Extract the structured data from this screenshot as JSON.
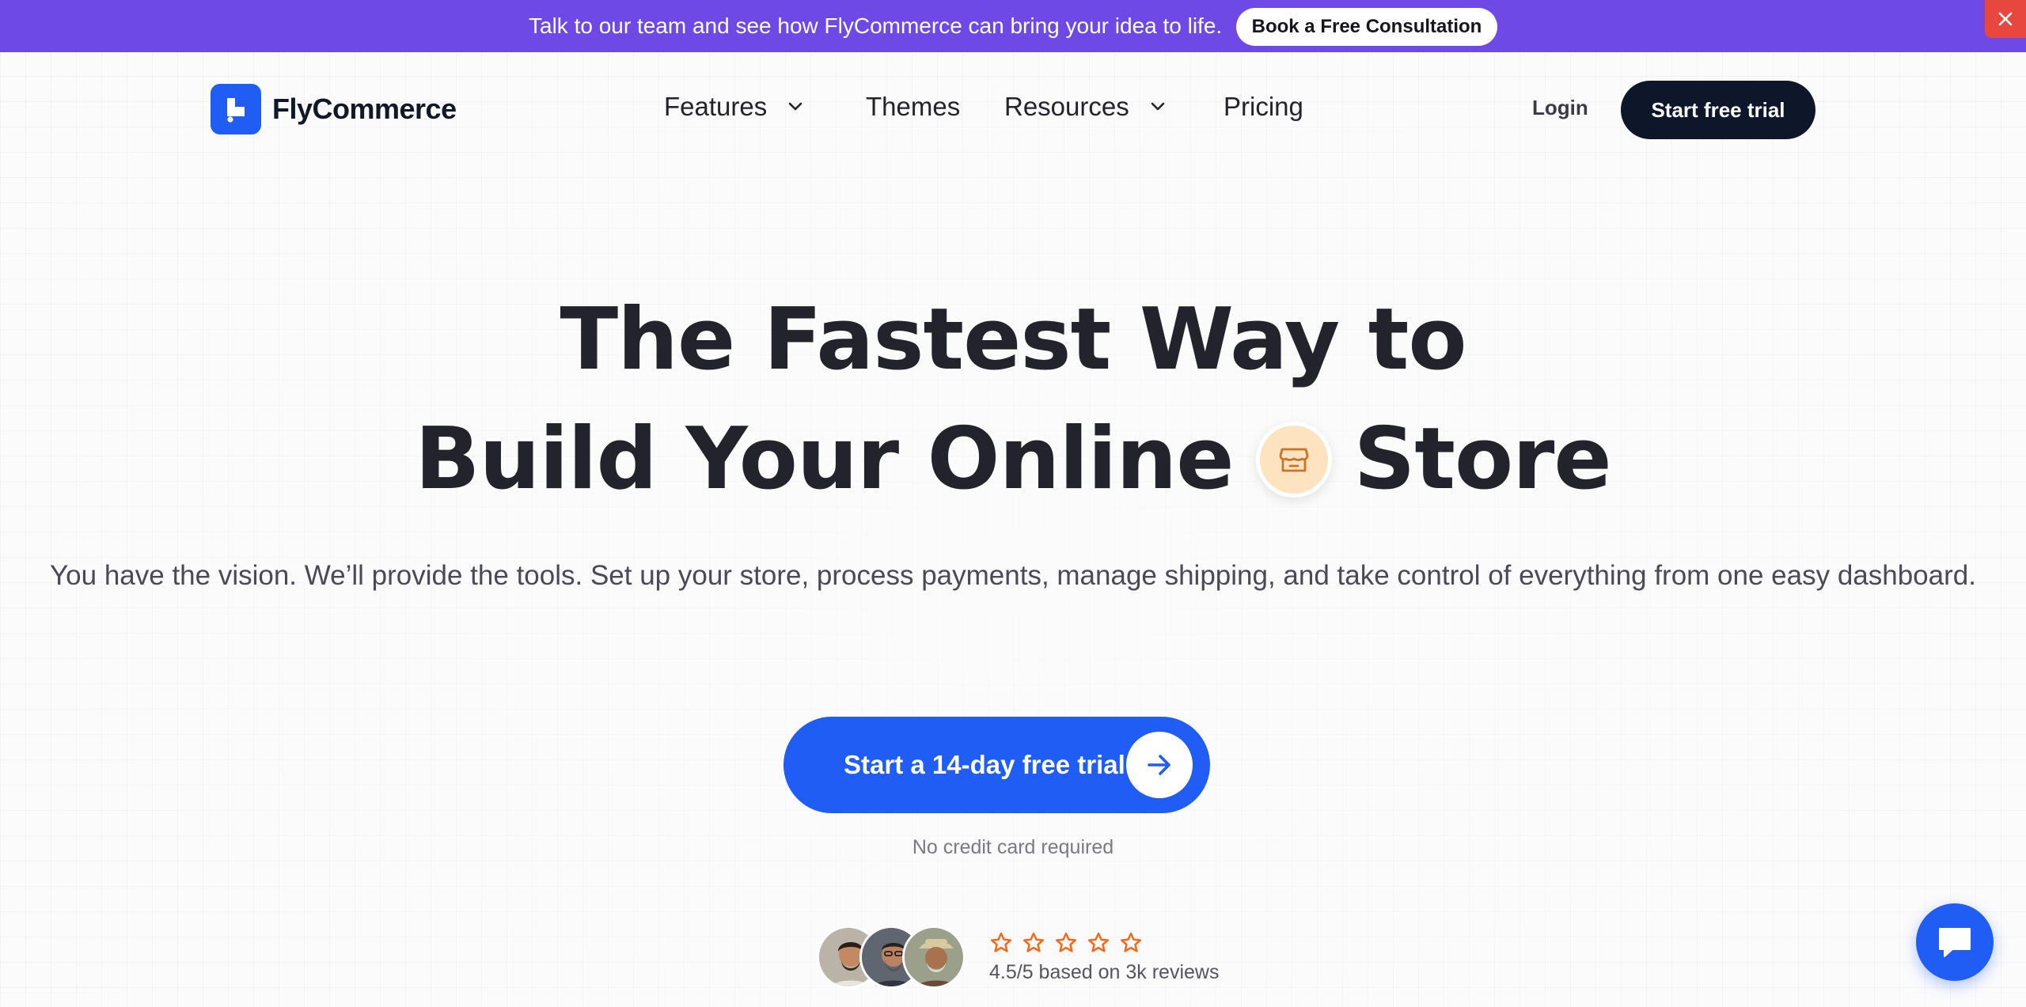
{
  "announcement": {
    "text": "Talk to our team and see how FlyCommerce can bring your idea to life.",
    "button_label": "Book a Free Consultation",
    "close_icon": "close-icon",
    "background_color": "#6f49e6"
  },
  "header": {
    "brand": "FlyCommerce",
    "nav": {
      "features": "Features",
      "themes": "Themes",
      "resources": "Resources",
      "pricing": "Pricing"
    },
    "login_label": "Login",
    "trial_label": "Start free trial"
  },
  "hero": {
    "headline_line1": "The Fastest Way to",
    "headline_line2_before": "Build Your Online",
    "headline_line2_after": "Store",
    "headline_icon": "storefront-icon",
    "subtext": "You have the vision. We’ll provide the tools. Set up your store, process payments, manage shipping, and take control of everything from one easy dashboard.",
    "cta_label": "Start a 14-day free trial",
    "cta_icon": "arrow-right-icon",
    "no_credit_card": "No credit card required",
    "rating_text": "4.5/5 based on 3k reviews",
    "star_count": 5
  },
  "chat": {
    "icon": "chat-icon"
  },
  "colors": {
    "primary": "#1f5df5",
    "dark": "#0e1629",
    "announcement": "#6f49e6",
    "close": "#e8473e",
    "star": "#f26a1b"
  }
}
